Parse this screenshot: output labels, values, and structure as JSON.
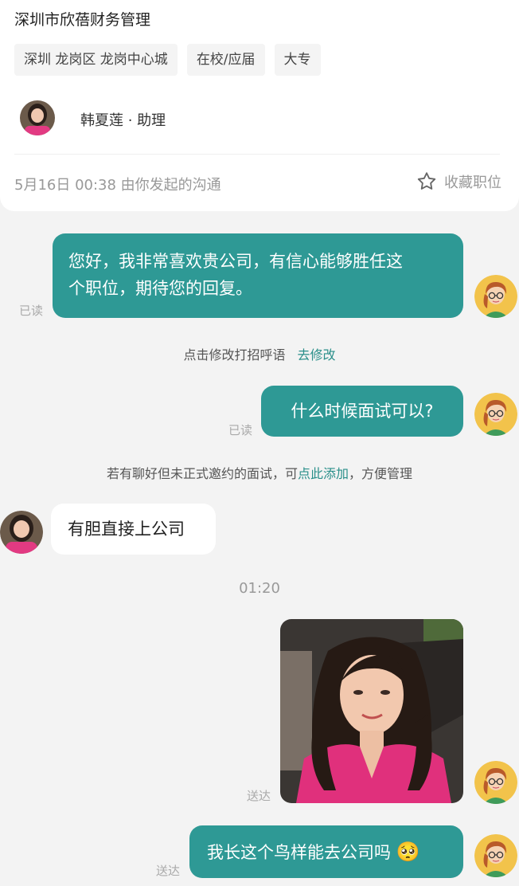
{
  "job": {
    "company": "深圳市欣蓓财务管理",
    "tags": [
      "深圳 龙岗区 龙岗中心城",
      "在校/应届",
      "大专"
    ],
    "recruiter": "韩夏莲 · 助理",
    "started_text": "5月16日 00:38 由你发起的沟通",
    "favorite_label": "收藏职位"
  },
  "chat": {
    "msg1": {
      "line1": "您好，我非常喜欢贵公司，有信心能够胜任这",
      "line2": "个职位，期待您的回复。",
      "status": "已读"
    },
    "hint": {
      "prefix": "点击修改打招呼语",
      "link": "去修改"
    },
    "msg2": {
      "text": "什么时候面试可以?",
      "status": "已读"
    },
    "notice": {
      "before": "若有聊好但未正式邀约的面试，可",
      "link": "点此添加",
      "after": "，方便管理"
    },
    "msg3": {
      "text": "有胆直接上公司"
    },
    "time_divider": "01:20",
    "photo_status": "送达",
    "msg4": {
      "text": "我长这个鸟样能去公司吗",
      "emoji": "🥺",
      "status": "送达"
    }
  },
  "colors": {
    "accent_teal": "#2e9995",
    "link_teal": "#2a8f8a",
    "background": "#f3f3f3"
  },
  "icons": {
    "favorite": "star-outline-icon",
    "self_avatar": "cartoon-girl-avatar",
    "recruiter_avatar": "woman-photo-avatar"
  }
}
